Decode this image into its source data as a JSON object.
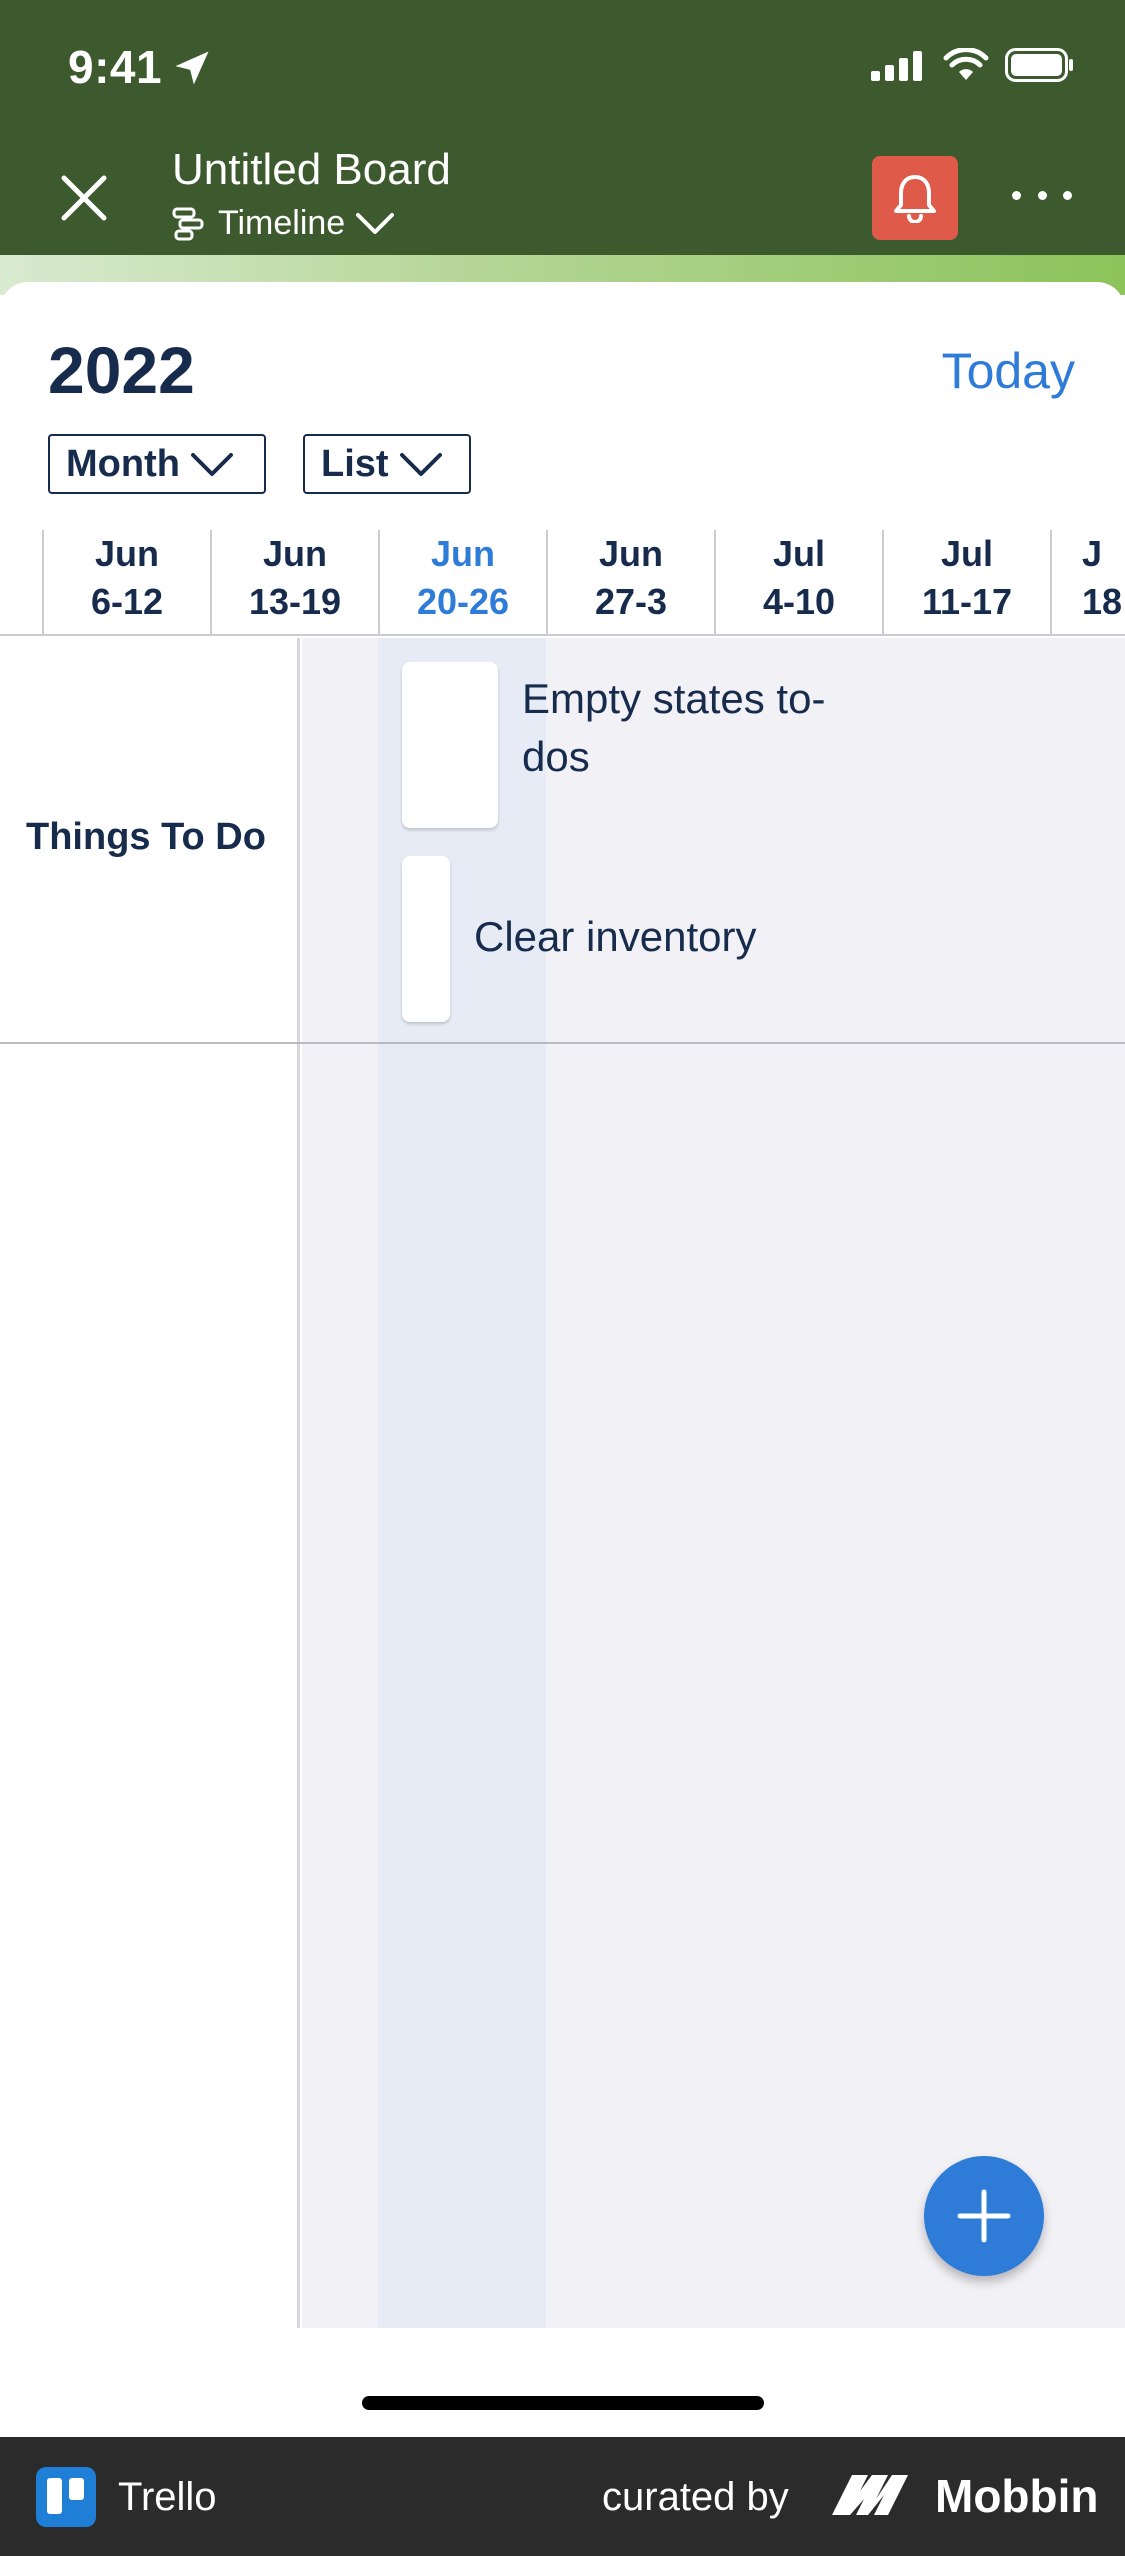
{
  "status_bar": {
    "time": "9:41"
  },
  "header": {
    "title": "Untitled Board",
    "view_label": "Timeline",
    "colors": {
      "background": "#3c5a2e",
      "bell_button": "#e05a4a"
    }
  },
  "toolbar": {
    "year": "2022",
    "today_label": "Today",
    "zoom_dropdown": "Month",
    "group_dropdown": "List"
  },
  "weeks": [
    {
      "month": "Jun",
      "days": "6-12",
      "current": false
    },
    {
      "month": "Jun",
      "days": "13-19",
      "current": false
    },
    {
      "month": "Jun",
      "days": "20-26",
      "current": true
    },
    {
      "month": "Jun",
      "days": "27-3",
      "current": false
    },
    {
      "month": "Jul",
      "days": "4-10",
      "current": false
    },
    {
      "month": "Jul",
      "days": "11-17",
      "current": false
    },
    {
      "month": "J",
      "days": "18",
      "current": false
    }
  ],
  "rows": [
    {
      "label": "Things To Do",
      "cards": [
        {
          "title": "Empty states to-dos"
        },
        {
          "title": "Clear inventory"
        }
      ]
    }
  ],
  "footer": {
    "app_name": "Trello",
    "curated_by": "curated by",
    "brand": "Mobbin"
  },
  "accent_color": "#2f7bd8"
}
